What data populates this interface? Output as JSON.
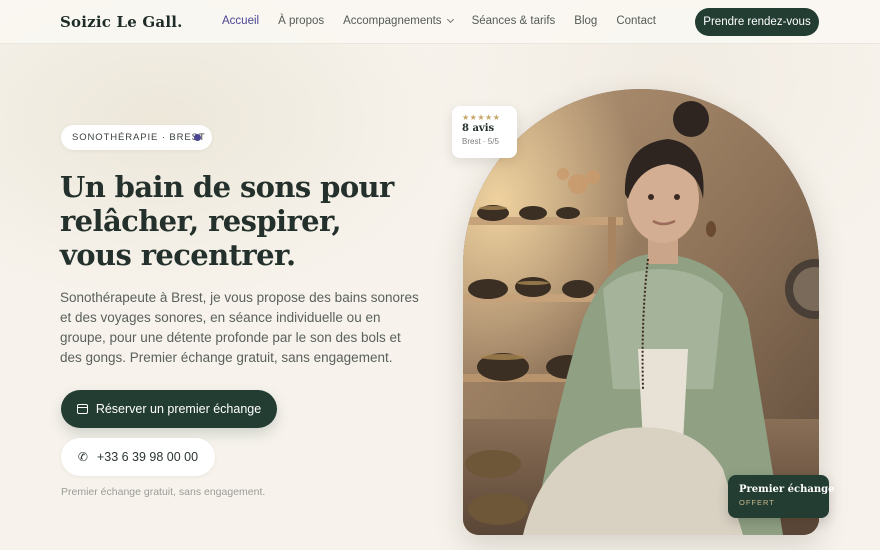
{
  "brand": "Soizic Le Gall.",
  "nav": {
    "items": [
      {
        "label": "Accueil",
        "active": true
      },
      {
        "label": "À propos"
      },
      {
        "label": "Accompagnements",
        "dropdown": true
      },
      {
        "label": "Séances & tarifs"
      },
      {
        "label": "Blog"
      },
      {
        "label": "Contact"
      }
    ],
    "cta": "Prendre rendez-vous"
  },
  "hero": {
    "tag": "SONOTHÉRAPIE · BREST",
    "headline": "Un bain de sons pour relâcher, respirer, vous recentrer.",
    "lead": "Sonothérapeute à Brest, je vous propose des bains sonores et des voyages sonores, en séance individuelle ou en groupe, pour une détente profonde par le son des bols et des gongs. Premier échange gratuit, sans engagement.",
    "primary_button": "Réserver un premier échange",
    "phone_button": "+33 6 39 98 00 00",
    "note": "Premier échange gratuit, sans engagement."
  },
  "rating": {
    "stars": "★★★★★",
    "count": "8 avis",
    "meta": "Brest · 5/5"
  },
  "offer": {
    "title": "Premier échange",
    "subtitle": "OFFERT"
  },
  "colors": {
    "background": "#f7f3ec",
    "accent": "#233d33",
    "active_link": "#4b4694",
    "star": "#c5a565"
  },
  "icons": {
    "calendar": "calendar-icon",
    "phone": "phone-icon",
    "dropdown": "chevron-down-icon"
  }
}
